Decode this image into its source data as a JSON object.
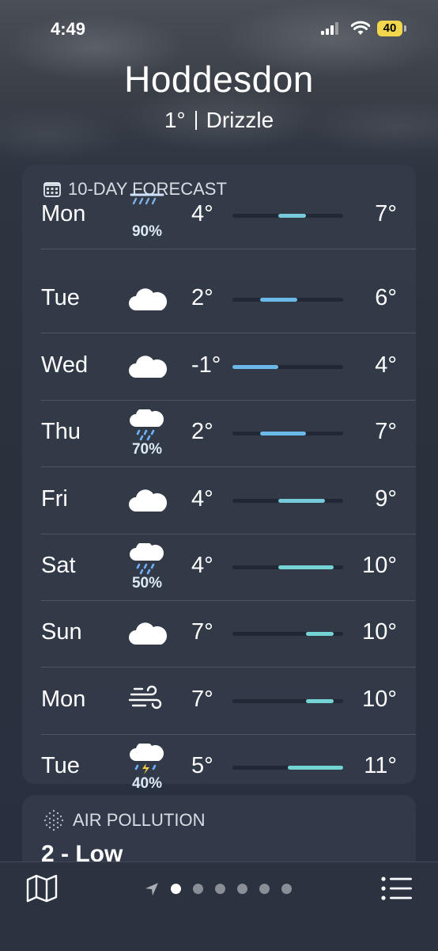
{
  "status_bar": {
    "time": "4:49",
    "battery": "40"
  },
  "location": {
    "city": "Hoddesdon",
    "temperature": "1°",
    "condition": "Drizzle"
  },
  "forecast": {
    "title": "10-DAY FORECAST",
    "days": [
      {
        "day": "Mon",
        "icon": "drizzle-icon",
        "pop": "90%",
        "low": "4°",
        "high": "7°"
      },
      {
        "day": "Tue",
        "icon": "cloud-icon",
        "pop": "",
        "low": "2°",
        "high": "6°"
      },
      {
        "day": "Wed",
        "icon": "cloud-icon",
        "pop": "",
        "low": "-1°",
        "high": "4°"
      },
      {
        "day": "Thu",
        "icon": "cloud-rain-icon",
        "pop": "70%",
        "low": "2°",
        "high": "7°"
      },
      {
        "day": "Fri",
        "icon": "cloud-icon",
        "pop": "",
        "low": "4°",
        "high": "9°"
      },
      {
        "day": "Sat",
        "icon": "cloud-rain-icon",
        "pop": "50%",
        "low": "4°",
        "high": "10°"
      },
      {
        "day": "Sun",
        "icon": "cloud-icon",
        "pop": "",
        "low": "7°",
        "high": "10°"
      },
      {
        "day": "Mon",
        "icon": "wind-icon",
        "pop": "",
        "low": "7°",
        "high": "10°"
      },
      {
        "day": "Tue",
        "icon": "thunderstorm-icon",
        "pop": "40%",
        "low": "5°",
        "high": "11°"
      }
    ]
  },
  "air_pollution": {
    "title": "AIR POLLUTION",
    "value": "2 - Low"
  },
  "bottom_bar": {
    "pages": 6,
    "active_page": 1
  }
}
